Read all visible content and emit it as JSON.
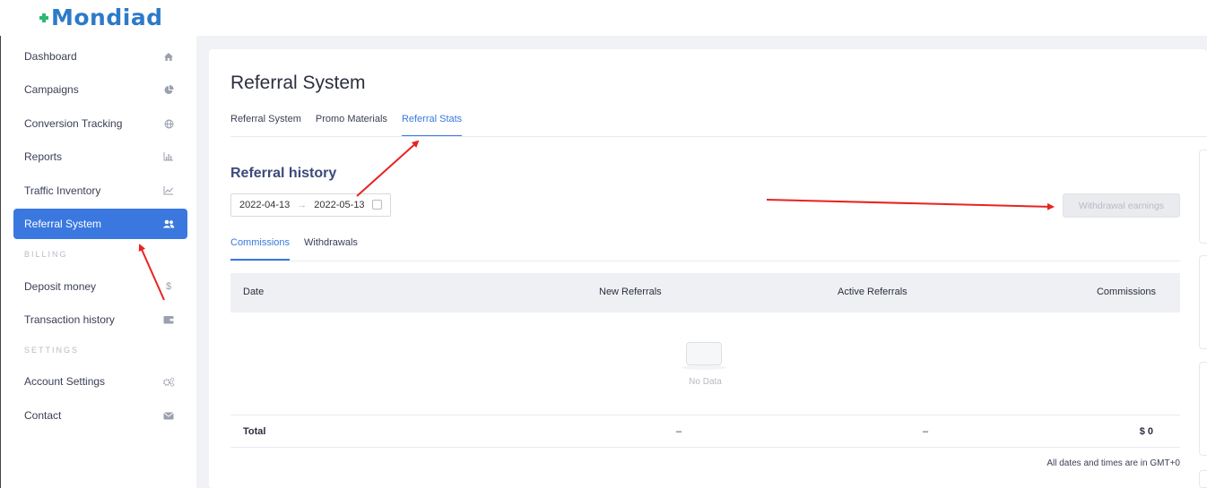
{
  "brand": {
    "name": "Mondiad",
    "accent": "#3a78e0",
    "logo_color": "#2d7ac9",
    "logo_mark_color": "#2eb872"
  },
  "sidebar": {
    "items": [
      {
        "label": "Dashboard",
        "icon": "home-icon"
      },
      {
        "label": "Campaigns",
        "icon": "pie-chart-icon"
      },
      {
        "label": "Conversion Tracking",
        "icon": "globe-icon"
      },
      {
        "label": "Reports",
        "icon": "bar-chart-icon"
      },
      {
        "label": "Traffic Inventory",
        "icon": "line-chart-icon"
      },
      {
        "label": "Referral System",
        "icon": "users-icon",
        "active": true
      }
    ],
    "billing_label": "BILLING",
    "billing_items": [
      {
        "label": "Deposit money",
        "icon": "dollar-icon"
      },
      {
        "label": "Transaction history",
        "icon": "wallet-icon"
      }
    ],
    "settings_label": "SETTINGS",
    "settings_items": [
      {
        "label": "Account Settings",
        "icon": "cogs-icon"
      },
      {
        "label": "Contact",
        "icon": "envelope-icon"
      }
    ]
  },
  "main": {
    "title": "Referral System",
    "tabs": [
      {
        "label": "Referral System"
      },
      {
        "label": "Promo Materials"
      },
      {
        "label": "Referral Stats",
        "active": true
      }
    ],
    "section_title": "Referral history",
    "date_range": {
      "start": "2022-04-13",
      "separator": "→",
      "end": "2022-05-13"
    },
    "withdraw_button": "Withdrawal earnings",
    "subtabs": [
      {
        "label": "Commissions",
        "active": true
      },
      {
        "label": "Withdrawals"
      }
    ],
    "table": {
      "headers": [
        "Date",
        "New Referrals",
        "Active Referrals",
        "Commissions"
      ],
      "empty_text": "No Data",
      "total_row": [
        "Total",
        "–",
        "–",
        "$ 0"
      ]
    },
    "timezone_note": "All dates and times are in GMT+0"
  }
}
